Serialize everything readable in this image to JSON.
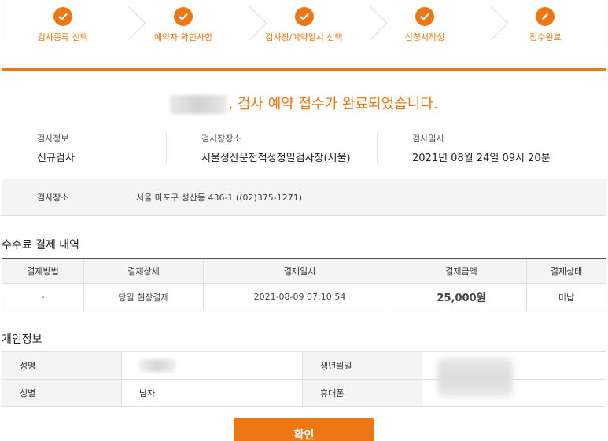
{
  "steps": [
    {
      "label": "검사종류 선택",
      "icon": "check-icon"
    },
    {
      "label": "예약자 확인사항",
      "icon": "check-icon"
    },
    {
      "label": "검사장/예약일시 선택",
      "icon": "check-icon"
    },
    {
      "label": "신청서작성",
      "icon": "check-icon"
    },
    {
      "label": "접수완료",
      "icon": "pencil-icon"
    }
  ],
  "completion": {
    "headline": ", 검사 예약 접수가 완료되었습니다.",
    "info": {
      "type_label": "검사정보",
      "type_value": "신규검사",
      "site_label": "검사장장소",
      "site_value": "서울성산운전적성정밀검사장(서울)",
      "datetime_label": "검사일시",
      "datetime_value": "2021년 08월 24일 09시 20분"
    },
    "place_label": "검사장소",
    "place_value": "서울 마포구 성산동 436-1 ((02)375-1271)"
  },
  "payment": {
    "title": "수수료 결제 내역",
    "headers": [
      "결제방법",
      "결제상세",
      "결제일시",
      "결제금액",
      "결제상태"
    ],
    "row": [
      "-",
      "당일 현장결제",
      "2021-08-09 07:10:54",
      "25,000원",
      "미납"
    ]
  },
  "personal": {
    "title": "개인정보",
    "name_label": "성명",
    "birth_label": "생년월일",
    "gender_label": "성별",
    "gender_value": "남자",
    "phone_label": "휴대폰"
  },
  "confirm_label": "확인",
  "colors": {
    "accent": "#ec7714",
    "amount": "#d8231c"
  }
}
